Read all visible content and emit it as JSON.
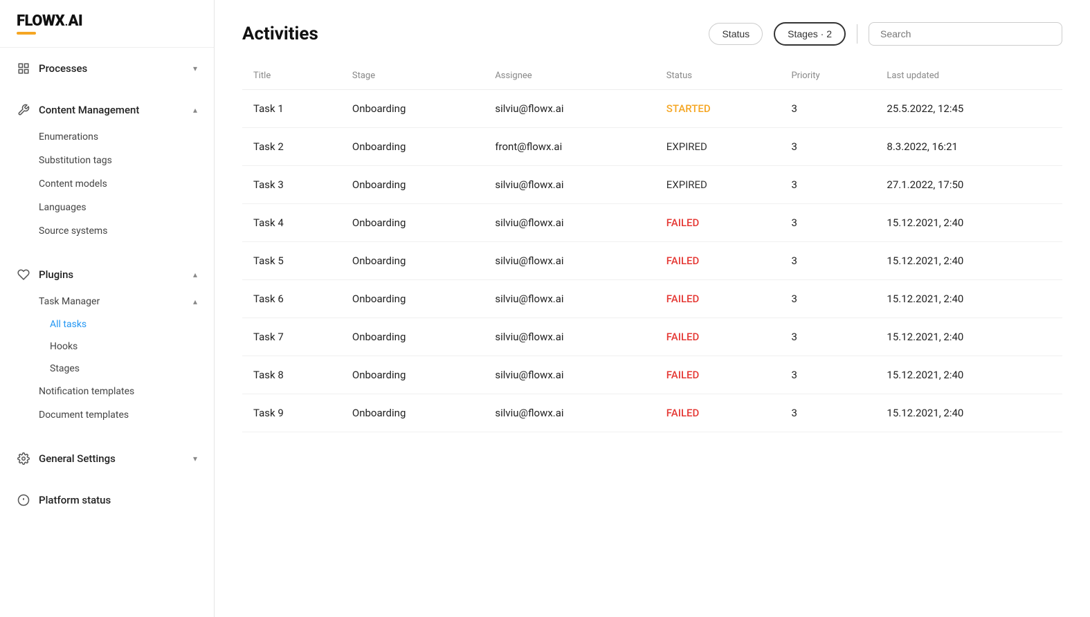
{
  "logo": {
    "text": "FLOWX.AI",
    "brand_color": "#f5a623"
  },
  "sidebar": {
    "sections": [
      {
        "label": "Processes",
        "icon": "processes-icon",
        "expanded": false,
        "children": []
      },
      {
        "label": "Content Management",
        "icon": "wrench-icon",
        "expanded": true,
        "children": [
          {
            "label": "Enumerations",
            "active": false
          },
          {
            "label": "Substitution tags",
            "active": false
          },
          {
            "label": "Content models",
            "active": false
          },
          {
            "label": "Languages",
            "active": false
          },
          {
            "label": "Source systems",
            "active": false
          }
        ]
      },
      {
        "label": "Plugins",
        "icon": "plugin-icon",
        "expanded": true,
        "children": [
          {
            "label": "Task Manager",
            "expanded": true,
            "children": [
              {
                "label": "All tasks",
                "active": true
              },
              {
                "label": "Hooks",
                "active": false
              },
              {
                "label": "Stages",
                "active": false
              }
            ]
          },
          {
            "label": "Notification templates",
            "active": false
          },
          {
            "label": "Document templates",
            "active": false
          }
        ]
      },
      {
        "label": "General Settings",
        "icon": "settings-icon",
        "expanded": false,
        "children": []
      },
      {
        "label": "Platform status",
        "icon": "info-icon",
        "expanded": false,
        "children": []
      }
    ]
  },
  "page": {
    "title": "Activities",
    "filters": {
      "status_label": "Status",
      "stages_label": "Stages · 2"
    },
    "search_placeholder": "Search"
  },
  "table": {
    "columns": [
      "Title",
      "Stage",
      "Assignee",
      "Status",
      "Priority",
      "Last updated"
    ],
    "rows": [
      {
        "title": "Task 1",
        "stage": "Onboarding",
        "assignee": "silviu@flowx.ai",
        "status": "STARTED",
        "priority": "3",
        "last_updated": "25.5.2022, 12:45"
      },
      {
        "title": "Task 2",
        "stage": "Onboarding",
        "assignee": "front@flowx.ai",
        "status": "EXPIRED",
        "priority": "3",
        "last_updated": "8.3.2022, 16:21"
      },
      {
        "title": "Task 3",
        "stage": "Onboarding",
        "assignee": "silviu@flowx.ai",
        "status": "EXPIRED",
        "priority": "3",
        "last_updated": "27.1.2022, 17:50"
      },
      {
        "title": "Task 4",
        "stage": "Onboarding",
        "assignee": "silviu@flowx.ai",
        "status": "FAILED",
        "priority": "3",
        "last_updated": "15.12.2021, 2:40"
      },
      {
        "title": "Task 5",
        "stage": "Onboarding",
        "assignee": "silviu@flowx.ai",
        "status": "FAILED",
        "priority": "3",
        "last_updated": "15.12.2021, 2:40"
      },
      {
        "title": "Task 6",
        "stage": "Onboarding",
        "assignee": "silviu@flowx.ai",
        "status": "FAILED",
        "priority": "3",
        "last_updated": "15.12.2021, 2:40"
      },
      {
        "title": "Task 7",
        "stage": "Onboarding",
        "assignee": "silviu@flowx.ai",
        "status": "FAILED",
        "priority": "3",
        "last_updated": "15.12.2021, 2:40"
      },
      {
        "title": "Task 8",
        "stage": "Onboarding",
        "assignee": "silviu@flowx.ai",
        "status": "FAILED",
        "priority": "3",
        "last_updated": "15.12.2021, 2:40"
      },
      {
        "title": "Task 9",
        "stage": "Onboarding",
        "assignee": "silviu@flowx.ai",
        "status": "FAILED",
        "priority": "3",
        "last_updated": "15.12.2021, 2:40"
      }
    ]
  }
}
